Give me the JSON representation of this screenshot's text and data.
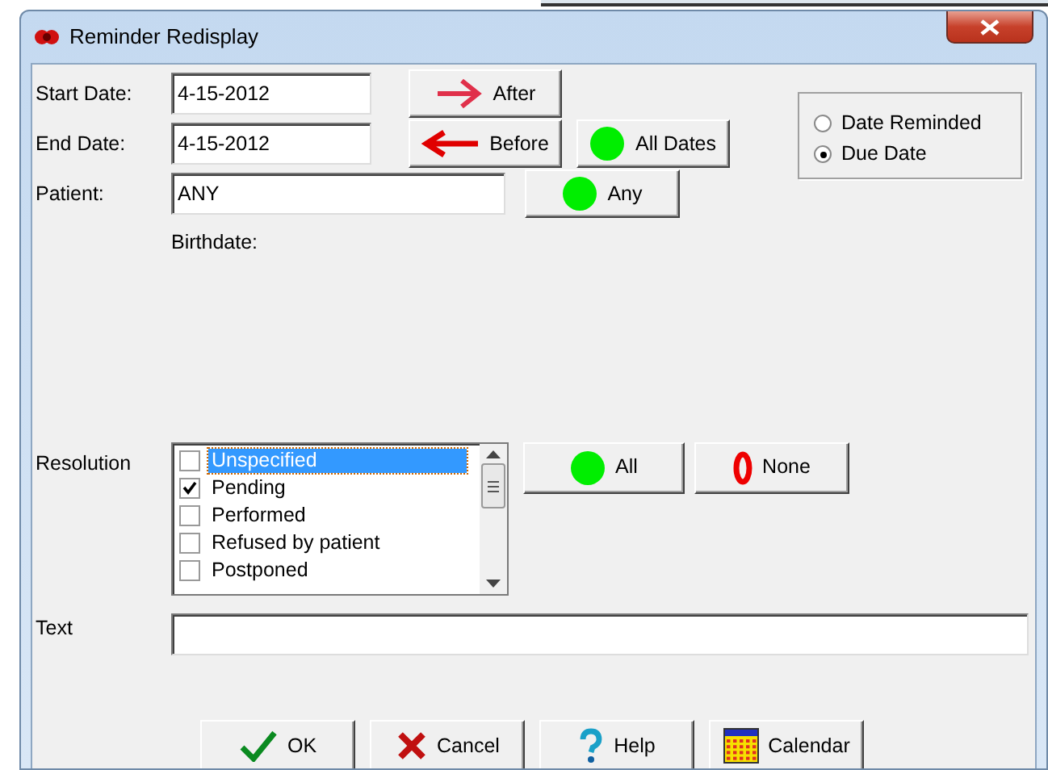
{
  "window": {
    "title": "Reminder Redisplay"
  },
  "start_date": {
    "label": "Start Date:",
    "value": "4-15-2012"
  },
  "end_date": {
    "label": "End Date:",
    "value": "4-15-2012"
  },
  "patient": {
    "label": "Patient:",
    "value": "ANY"
  },
  "birthdate": {
    "label": "Birthdate:"
  },
  "date_buttons": [
    {
      "label": "After",
      "kind": "after"
    },
    {
      "label": "Before",
      "kind": "before"
    },
    {
      "label": "All Dates",
      "kind": "all"
    },
    {
      "label": "Any",
      "kind": "all"
    }
  ],
  "date_type": [
    {
      "label": "Date Reminded",
      "selected": false
    },
    {
      "label": "Due Date",
      "selected": true
    }
  ],
  "resolution": {
    "label": "Resolution",
    "items": [
      {
        "label": "Unspecified",
        "checked": false,
        "selected": true
      },
      {
        "label": "Pending",
        "checked": true,
        "selected": false
      },
      {
        "label": "Performed",
        "checked": false,
        "selected": false
      },
      {
        "label": "Refused by patient",
        "checked": false,
        "selected": false
      },
      {
        "label": "Postponed",
        "checked": false,
        "selected": false
      }
    ],
    "buttons": [
      {
        "label": "All",
        "kind": "all"
      },
      {
        "label": "None",
        "kind": "none"
      }
    ]
  },
  "text": {
    "label": "Text"
  },
  "buttons": [
    {
      "label": "OK",
      "kind": "ok"
    },
    {
      "label": "Cancel",
      "kind": "cancel"
    },
    {
      "label": "Help",
      "kind": "help"
    },
    {
      "label": "Calendar",
      "kind": "calendar"
    }
  ]
}
